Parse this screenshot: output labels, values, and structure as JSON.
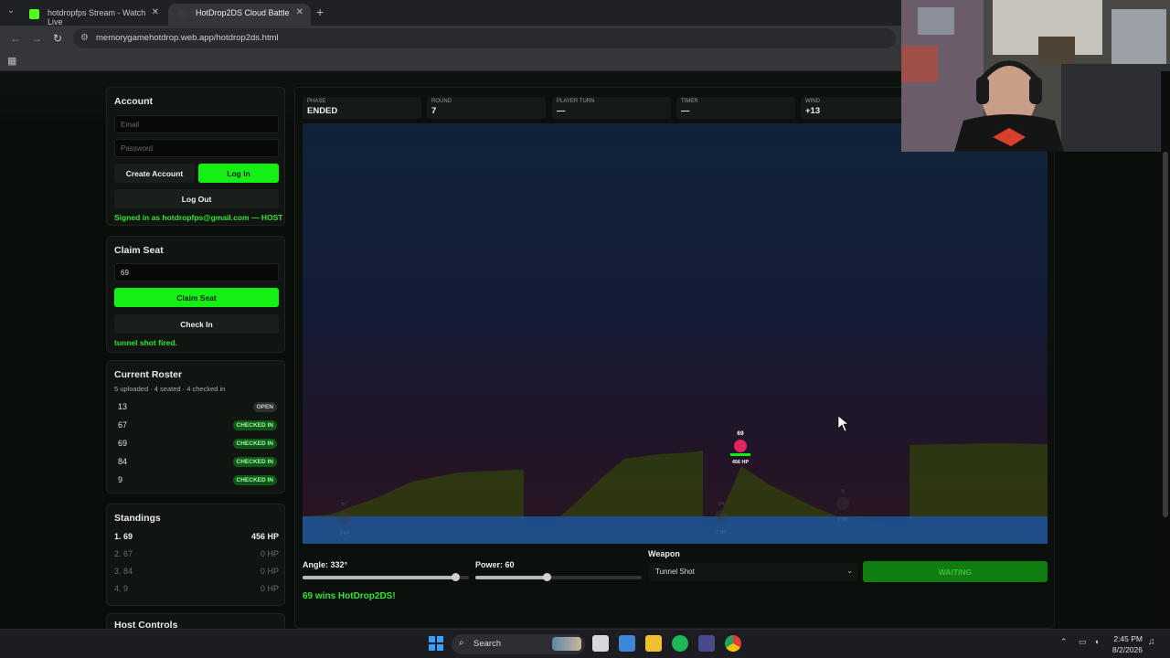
{
  "browser": {
    "tabs": [
      {
        "label": "hotdropfps Stream - Watch Live",
        "active": false
      },
      {
        "label": "HotDrop2DS Cloud Battle",
        "active": true
      }
    ],
    "url": "memorygamehotdrop.web.app/hotdrop2ds.html"
  },
  "account": {
    "title": "Account",
    "email_placeholder": "Email",
    "password_placeholder": "Password",
    "create_label": "Create Account",
    "login_label": "Log In",
    "logout_label": "Log Out",
    "status": "Signed in as hotdropfps@gmail.com — HOST"
  },
  "claim": {
    "title": "Claim Seat",
    "seat_value": "69",
    "claim_label": "Claim Seat",
    "checkin_label": "Check In",
    "status": "tunnel shot fired."
  },
  "roster": {
    "title": "Current Roster",
    "summary": "5 uploaded · 4 seated · 4 checked in",
    "rows": [
      {
        "seat": "13",
        "status": "OPEN"
      },
      {
        "seat": "67",
        "status": "CHECKED IN"
      },
      {
        "seat": "69",
        "status": "CHECKED IN"
      },
      {
        "seat": "84",
        "status": "CHECKED IN"
      },
      {
        "seat": "9",
        "status": "CHECKED IN"
      }
    ]
  },
  "standings": {
    "title": "Standings",
    "rows": [
      {
        "name": "1. 69",
        "hp": "456 HP",
        "alive": true
      },
      {
        "name": "2. 67",
        "hp": "0 HP",
        "alive": false
      },
      {
        "name": "3. 84",
        "hp": "0 HP",
        "alive": false
      },
      {
        "name": "4. 9",
        "hp": "0 HP",
        "alive": false
      }
    ]
  },
  "host_controls": {
    "title": "Host Controls"
  },
  "game": {
    "stats": [
      {
        "label": "PHASE",
        "value": "ENDED"
      },
      {
        "label": "ROUND",
        "value": "7"
      },
      {
        "label": "PLAYER TURN",
        "value": "—"
      },
      {
        "label": "TIMER",
        "value": "—"
      },
      {
        "label": "WIND",
        "value": "+13"
      }
    ],
    "players": [
      {
        "name": "69",
        "hp": "456 HP",
        "hp_fraction": 1.0,
        "alive": true
      },
      {
        "name": "67",
        "hp": "0 HP",
        "alive": false
      },
      {
        "name": "84",
        "hp": "0 HP",
        "alive": false
      },
      {
        "name": "9",
        "hp": "0 HP",
        "alive": false
      }
    ],
    "angle_label": "Angle: 332°",
    "angle_fraction": 0.92,
    "power_label": "Power: 60",
    "power_fraction": 0.43,
    "weapon_label": "Weapon",
    "weapon_value": "Tunnel Shot",
    "fire_label": "WAITING",
    "win_message": "69 wins HotDrop2DS!"
  },
  "taskbar": {
    "search_label": "Search",
    "time": "2:45 PM",
    "date": "8/2/2026"
  },
  "colors": {
    "accent_green": "#14f014",
    "player_red": "#e0245e",
    "water_blue": "#1e4f8f",
    "terrain": "#2f3a10"
  }
}
